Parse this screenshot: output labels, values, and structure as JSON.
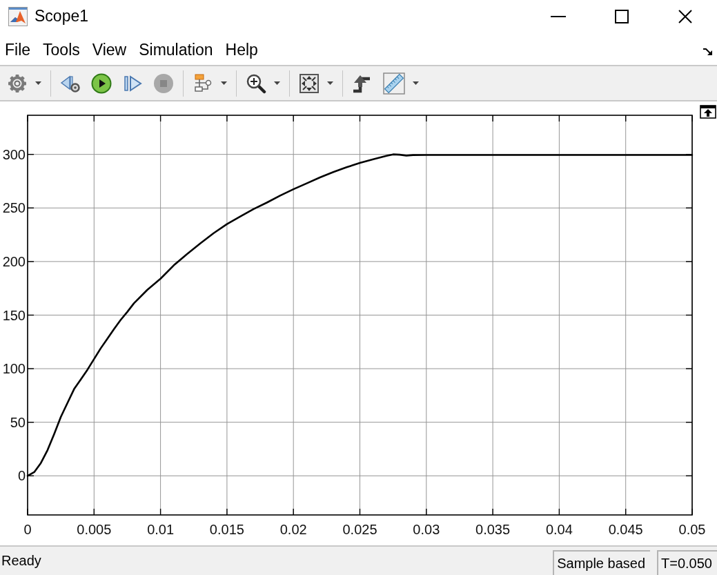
{
  "window": {
    "title": "Scope1"
  },
  "menu_bar": {
    "items": [
      "File",
      "Tools",
      "View",
      "Simulation",
      "Help"
    ]
  },
  "toolbar": {
    "groups": [
      {
        "items": [
          {
            "kind": "settings",
            "dropdown": true,
            "disabled": false
          }
        ]
      },
      {
        "items": [
          {
            "kind": "step_back",
            "dropdown": false,
            "disabled": false
          },
          {
            "kind": "run",
            "dropdown": false,
            "disabled": false
          },
          {
            "kind": "step_forward",
            "dropdown": false,
            "disabled": false
          },
          {
            "kind": "stop",
            "dropdown": false,
            "disabled": true
          }
        ]
      },
      {
        "items": [
          {
            "kind": "highlight_block",
            "dropdown": true,
            "disabled": false
          }
        ]
      },
      {
        "items": [
          {
            "kind": "zoom",
            "dropdown": true,
            "disabled": false
          }
        ]
      },
      {
        "items": [
          {
            "kind": "fit",
            "dropdown": true,
            "disabled": false
          }
        ]
      },
      {
        "items": [
          {
            "kind": "triggers",
            "dropdown": false,
            "disabled": false
          },
          {
            "kind": "measure",
            "dropdown": true,
            "disabled": false
          }
        ]
      }
    ]
  },
  "plot": {
    "chart_data": {
      "type": "line",
      "grid": true,
      "x": [
        0,
        0.0005,
        0.001,
        0.0015,
        0.002,
        0.0025,
        0.003,
        0.0035,
        0.004,
        0.0045,
        0.005,
        0.0055,
        0.006,
        0.0065,
        0.007,
        0.0075,
        0.008,
        0.009,
        0.01,
        0.011,
        0.012,
        0.013,
        0.014,
        0.015,
        0.016,
        0.017,
        0.018,
        0.019,
        0.02,
        0.021,
        0.022,
        0.023,
        0.024,
        0.025,
        0.026,
        0.027,
        0.0275,
        0.028,
        0.0285,
        0.029,
        0.03,
        0.035,
        0.04,
        0.045,
        0.05
      ],
      "values": [
        0,
        3.5,
        12,
        24,
        39,
        55,
        68,
        81,
        90,
        99,
        109,
        119,
        128,
        137,
        145.5,
        153,
        161,
        173.5,
        184,
        196.5,
        207,
        217,
        226.5,
        235,
        242,
        249,
        255,
        261.5,
        267.5,
        273,
        278.5,
        283.5,
        288,
        292,
        295.5,
        298.7,
        300,
        299.7,
        298.8,
        299.4,
        299.5,
        299.5,
        299.5,
        299.5,
        299.5
      ],
      "xlim": [
        0,
        0.05
      ],
      "ylim": [
        -36.5,
        336.5
      ],
      "xticks": [
        0,
        0.005,
        0.01,
        0.015,
        0.02,
        0.025,
        0.03,
        0.035,
        0.04,
        0.045,
        0.05
      ],
      "yticks": [
        0,
        50,
        100,
        150,
        200,
        250,
        300
      ]
    }
  },
  "status_bar": {
    "message": "Ready",
    "sections": [
      "Sample based",
      "T=0.050"
    ]
  }
}
